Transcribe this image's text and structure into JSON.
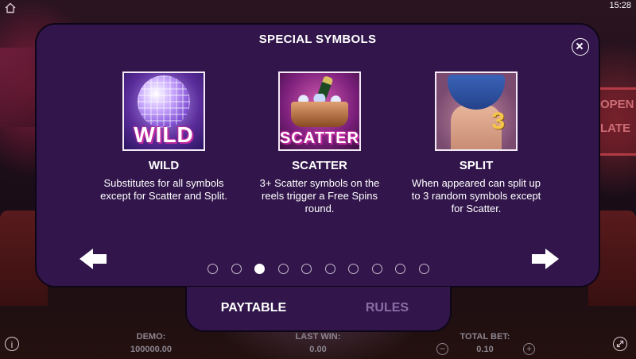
{
  "status_bar": {
    "time": "15:28"
  },
  "modal": {
    "title": "SPECIAL SYMBOLS",
    "symbols": [
      {
        "name": "WILD",
        "art_text": "WILD",
        "description": "Substitutes for all symbols except for Scatter and Split."
      },
      {
        "name": "SCATTER",
        "art_text": "SCATTER",
        "description": "3+ Scatter symbols on the reels trigger a Free Spins round."
      },
      {
        "name": "SPLIT",
        "art_text": "3",
        "description": "When appeared can split up to 3 random symbols except for Scatter."
      }
    ],
    "pagination": {
      "total_pages": 10,
      "current_page": 3
    }
  },
  "tabs": [
    {
      "label": "PAYTABLE",
      "active": true
    },
    {
      "label": "RULES",
      "active": false
    }
  ],
  "bottom_bar": {
    "demo_label": "DEMO:",
    "demo_value": "100000.00",
    "last_win_label": "LAST WIN:",
    "last_win_value": "0.00",
    "total_bet_label": "TOTAL BET:",
    "total_bet_value": "0.10",
    "minus_symbol": "−",
    "plus_symbol": "+",
    "info_symbol": "i"
  },
  "background": {
    "sign_text_line1": "OPEN",
    "sign_text_line2": "LATE"
  },
  "colors": {
    "modal_bg": "#32164b",
    "text_active": "#ffffff",
    "text_inactive": "#8a6fa6"
  },
  "icons": [
    "home-icon",
    "close-icon",
    "arrow-left-icon",
    "arrow-right-icon",
    "info-icon",
    "expand-icon"
  ]
}
